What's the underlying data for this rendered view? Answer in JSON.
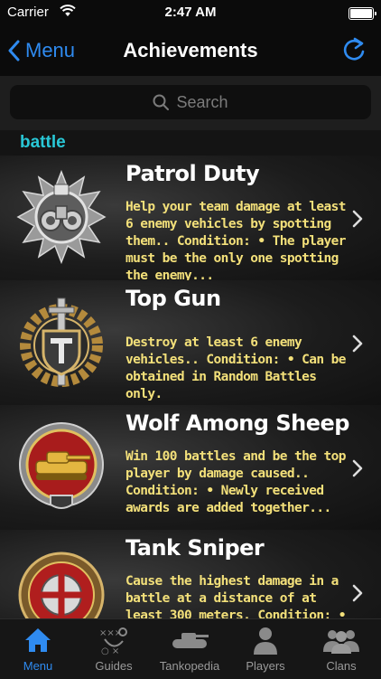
{
  "status": {
    "carrier": "Carrier",
    "time": "2:47 AM"
  },
  "nav": {
    "back_label": "Menu",
    "title": "Achievements"
  },
  "search": {
    "placeholder": "Search"
  },
  "section": {
    "title": "battle"
  },
  "achievements": [
    {
      "name": "Patrol Duty",
      "description": "Help your team damage at least 6 enemy vehicles by spotting them.. Condition: • The player must be the only one spotting the enemy...",
      "medal": "binoculars-medal-icon"
    },
    {
      "name": "Top Gun",
      "description": "Destroy at least 6 enemy vehicles.. Condition: • Can be obtained in Random Battles only.",
      "medal": "sword-shield-medal-icon"
    },
    {
      "name": "Wolf Among Sheep",
      "description": "Win 100 battles and be the top player by damage caused.. Condition: • Newly received awards are added together...",
      "medal": "gold-tank-medal-icon"
    },
    {
      "name": "Tank Sniper",
      "description": "Cause the highest damage in a battle at a distance of at least 300 meters. Condition: • Fire at least",
      "medal": "crosshair-medal-icon"
    }
  ],
  "tabs": [
    {
      "label": "Menu",
      "icon": "home-icon",
      "active": true
    },
    {
      "label": "Guides",
      "icon": "playbook-icon",
      "active": false
    },
    {
      "label": "Tankopedia",
      "icon": "tank-icon",
      "active": false
    },
    {
      "label": "Players",
      "icon": "person-icon",
      "active": false
    },
    {
      "label": "Clans",
      "icon": "group-icon",
      "active": false
    }
  ],
  "colors": {
    "accent": "#2f8bf0",
    "section": "#29c7d6",
    "description": "#f3e07a"
  }
}
